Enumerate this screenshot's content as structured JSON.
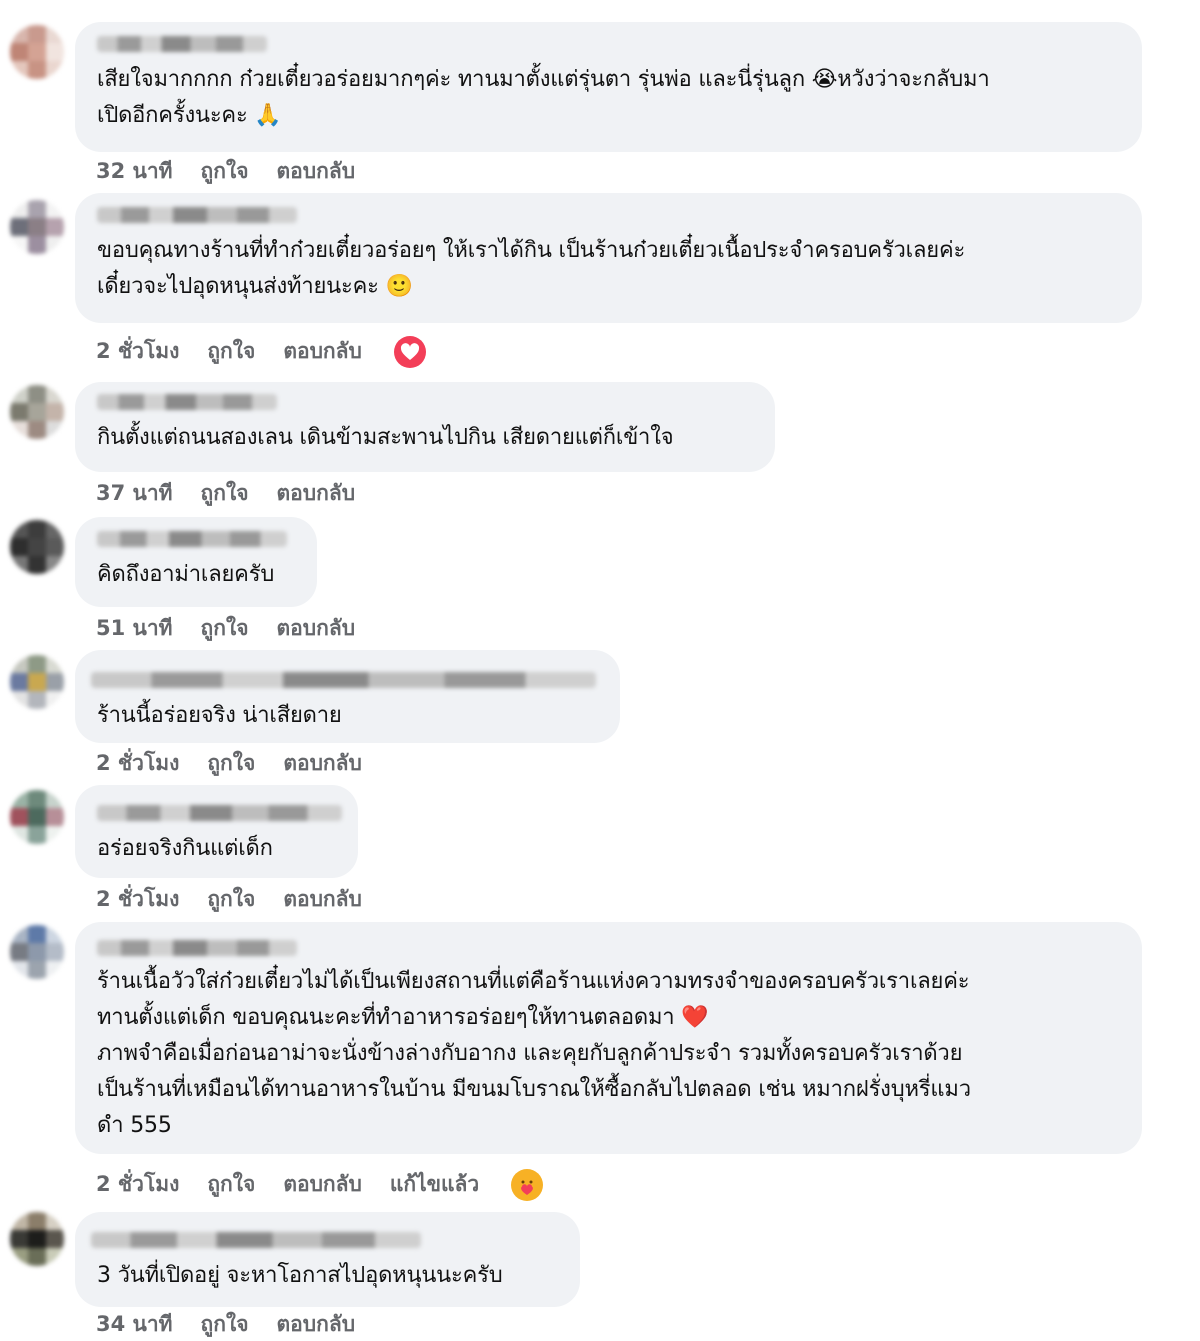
{
  "actions": {
    "like": "ถูกใจ",
    "reply": "ตอบกลับ",
    "edited": "แก้ไขแล้ว"
  },
  "comments": [
    {
      "lines": [
        "เสียใจมากกกก ก๋วยเตี๋ยวอร่อยมากๆค่ะ ทานมาตั้งแต่รุ่นตา รุ่นพ่อ และนี่รุ่นลูก 😭หวังว่าจะกลับมา",
        "เปิดอีกครั้งนะคะ 🙏"
      ],
      "time": "32 นาที"
    },
    {
      "lines": [
        "ขอบคุณทางร้านที่ทำก๋วยเตี๋ยวอร่อยๆ ให้เราได้กิน เป็นร้านก๋วยเตี๋ยวเนื้อประจำครอบครัวเลยค่ะ",
        "เดี๋ยวจะไปอุดหนุนส่งท้ายนะคะ 🙂"
      ],
      "time": "2 ชั่วโมง",
      "reaction": "love-reaction-icon"
    },
    {
      "lines": [
        "กินตั้งแต่ถนนสองเลน เดินข้ามสะพานไปกิน เสียดายแต่ก็เข้าใจ"
      ],
      "time": "37 นาที"
    },
    {
      "lines": [
        "คิดถึงอาม่าเลยครับ"
      ],
      "time": "51 นาที"
    },
    {
      "lines": [
        "ร้านนี้อร่อยจริง น่าเสียดาย"
      ],
      "time": "2 ชั่วโมง"
    },
    {
      "lines": [
        "อร่อยจริงกินแต่เด็ก"
      ],
      "time": "2 ชั่วโมง"
    },
    {
      "lines": [
        "ร้านเนื้อวัวใส่ก๋วยเตี๋ยวไม่ได้เป็นเพียงสถานที่แต่คือร้านแห่งความทรงจำของครอบครัวเราเลยค่ะ",
        "ทานตั้งแต่เด็ก ขอบคุณนะคะที่ทำอาหารอร่อยๆให้ทานตลอดมา ❤️",
        "ภาพจำคือเมื่อก่อนอาม่าจะนั่งข้างล่างกับอากง และคุยกับลูกค้าประจำ รวมทั้งครอบครัวเราด้วย",
        "เป็นร้านที่เหมือนได้ทานอาหารในบ้าน มีขนมโบราณให้ซื้อกลับไปตลอด เช่น หมากฝรั่งบุหรี่แมว",
        "ดำ 555"
      ],
      "time": "2 ชั่วโมง",
      "edited": true,
      "reaction": "hug-reaction-icon"
    },
    {
      "lines": [
        "3 วันที่เปิดอยู่ จะหาโอกาสไปอุดหนุนนะครับ"
      ],
      "time": "34 นาที"
    }
  ],
  "colors": {
    "bubble": "#f0f2f5",
    "meta_text": "#65676b",
    "love_reaction": "#f33e58",
    "hug_reaction": "#f7b125"
  }
}
